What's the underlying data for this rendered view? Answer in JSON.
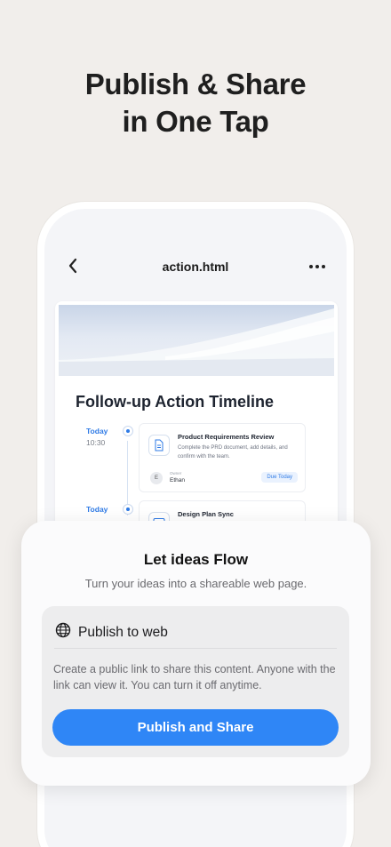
{
  "headline": {
    "line1": "Publish & Share",
    "line2": "in One Tap"
  },
  "nav": {
    "title": "action.html",
    "back_icon": "chevron-left-icon",
    "more_icon": "more-horizontal-icon"
  },
  "document": {
    "title": "Follow-up Action Timeline",
    "items": [
      {
        "date": "Today",
        "time": "10:30",
        "title": "Product Requirements Review",
        "description": "Complete the PRD document, add details, and confirm with the team.",
        "owner_label": "Owner",
        "owner_initial": "E",
        "owner_name": "Ethan",
        "badge": "Due Today"
      },
      {
        "date": "Today",
        "title": "Design Plan Sync"
      }
    ]
  },
  "sheet": {
    "title": "Let ideas Flow",
    "subtitle": "Turn your ideas into a shareable web page.",
    "option_icon": "globe-icon",
    "option_label": "Publish to web",
    "description": "Create a public link to share this content. Anyone with the link can view it. You can turn it off anytime.",
    "button_label": "Publish and Share"
  },
  "colors": {
    "accent": "#2f86f6",
    "background": "#f1eeeb",
    "date_blue": "#2f7be6"
  }
}
